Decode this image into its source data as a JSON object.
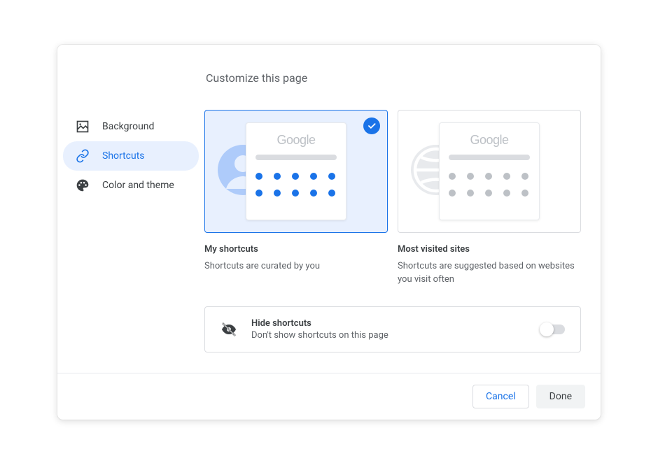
{
  "dialog": {
    "title": "Customize this page"
  },
  "sidebar": {
    "items": [
      {
        "id": "background",
        "label": "Background",
        "active": false
      },
      {
        "id": "shortcuts",
        "label": "Shortcuts",
        "active": true
      },
      {
        "id": "color-theme",
        "label": "Color and theme",
        "active": false
      }
    ]
  },
  "shortcuts": {
    "options": [
      {
        "id": "my-shortcuts",
        "title": "My shortcuts",
        "description": "Shortcuts are curated by you",
        "selected": true,
        "preview_logo": "Google",
        "dot_color": "blue",
        "bg_icon": "avatar"
      },
      {
        "id": "most-visited",
        "title": "Most visited sites",
        "description": "Shortcuts are suggested based on websites you visit often",
        "selected": false,
        "preview_logo": "Google",
        "dot_color": "gray",
        "bg_icon": "globe"
      }
    ],
    "hide": {
      "title": "Hide shortcuts",
      "description": "Don't show shortcuts on this page",
      "enabled": false
    }
  },
  "footer": {
    "cancel": "Cancel",
    "done": "Done"
  },
  "colors": {
    "accent": "#1a73e8",
    "accent_bg": "#e8f0fe",
    "border": "#dadce0",
    "text_primary": "#3c4043",
    "text_secondary": "#5f6368"
  }
}
